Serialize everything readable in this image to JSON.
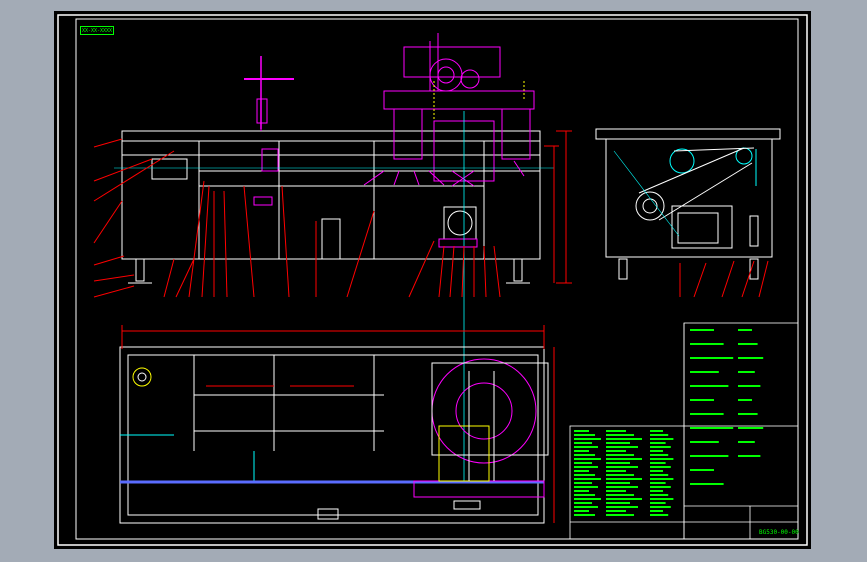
{
  "drawing": {
    "title_label": "XX-XX-XXXX",
    "drawing_code": "BG530-00-00"
  },
  "colors": {
    "background": "#000000",
    "frame": "#ffffff",
    "geometry": "#ffffff",
    "dimension": "#ff0000",
    "annotation": "#00ff00",
    "centerline": "#00ffff",
    "highlight": "#ff00ff",
    "hidden": "#ffff00"
  },
  "views": [
    "front-elevation",
    "side-elevation",
    "plan-view",
    "parts-list",
    "title-block"
  ]
}
